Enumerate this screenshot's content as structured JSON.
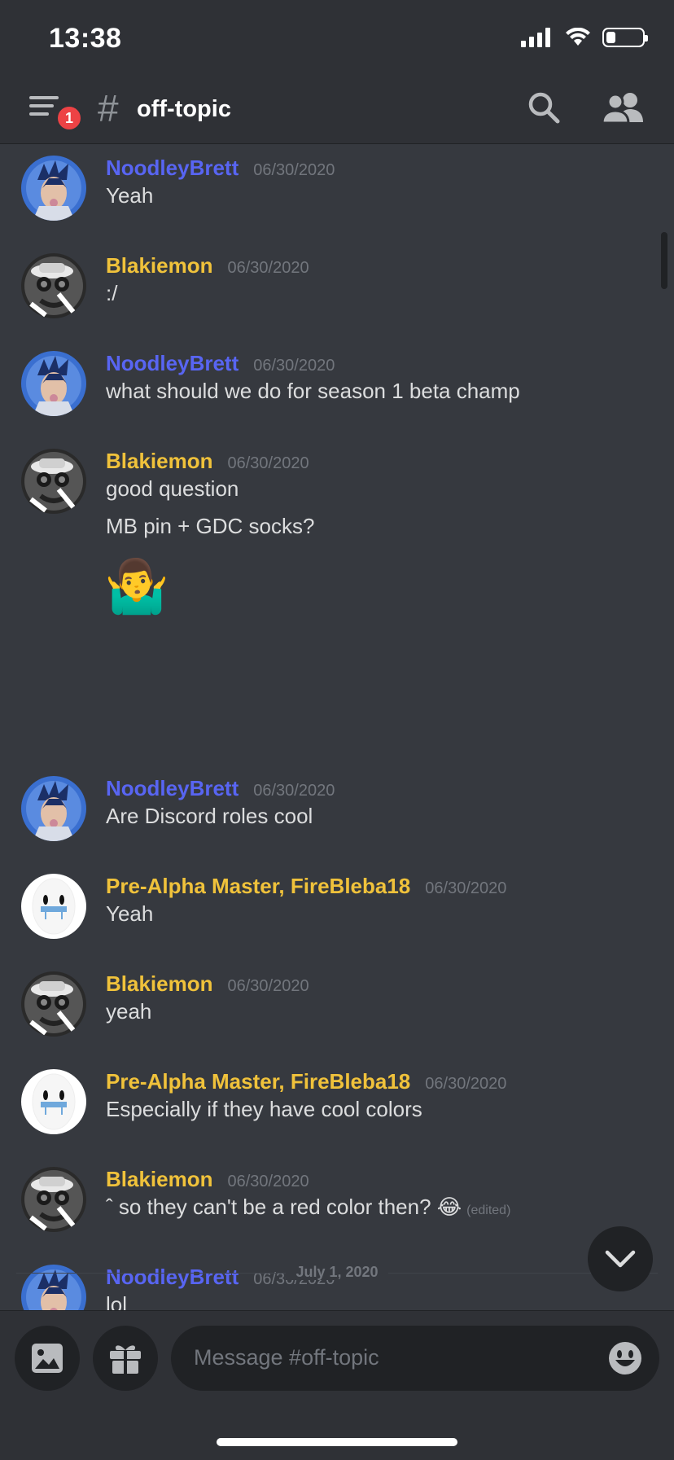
{
  "status_bar": {
    "time": "13:38",
    "battery_level": 0.25
  },
  "header": {
    "notification_count": "1",
    "channel_hash": "#",
    "channel_name": "off-topic"
  },
  "colors": {
    "blue_name": "#5865f2",
    "yellow_name": "#f0c23b",
    "background": "#36393f",
    "header_bg": "#2f3136"
  },
  "messages": [
    {
      "author": "NoodleyBrett",
      "color": "blue",
      "timestamp": "06/30/2020",
      "lines": [
        "Yeah"
      ]
    },
    {
      "author": "Blakiemon",
      "color": "yellow",
      "timestamp": "06/30/2020",
      "lines": [
        ":/"
      ]
    },
    {
      "author": "NoodleyBrett",
      "color": "blue",
      "timestamp": "06/30/2020",
      "lines": [
        "what should we do for season 1 beta champ"
      ]
    },
    {
      "author": "Blakiemon",
      "color": "yellow",
      "timestamp": "06/30/2020",
      "lines": [
        "good question",
        "MB pin + GDC socks?"
      ],
      "emoji": "🤷‍♂️"
    },
    {
      "author": "NoodleyBrett",
      "color": "blue",
      "timestamp": "06/30/2020",
      "lines": [
        "Are Discord roles cool"
      ]
    },
    {
      "author": "Pre-Alpha Master, FireBleba18",
      "color": "yellow",
      "timestamp": "06/30/2020",
      "lines": [
        "Yeah"
      ]
    },
    {
      "author": "Blakiemon",
      "color": "yellow",
      "timestamp": "06/30/2020",
      "lines": [
        "yeah"
      ]
    },
    {
      "author": "Pre-Alpha Master, FireBleba18",
      "color": "yellow",
      "timestamp": "06/30/2020",
      "lines": [
        "Especially if they have cool colors"
      ]
    },
    {
      "author": "Blakiemon",
      "color": "yellow",
      "timestamp": "06/30/2020",
      "lines": [
        "ˆ so they can't be a red color then? 😂"
      ],
      "edited": "(edited)"
    },
    {
      "author": "NoodleyBrett",
      "color": "blue",
      "timestamp": "06/30/2020",
      "lines": [
        "lol"
      ]
    }
  ],
  "date_divider": "July 1, 2020",
  "composer": {
    "placeholder": "Message #off-topic"
  },
  "icons": [
    "menu-icon",
    "search-icon",
    "members-icon",
    "image-icon",
    "gift-icon",
    "emoji-icon",
    "chevron-down-icon"
  ]
}
